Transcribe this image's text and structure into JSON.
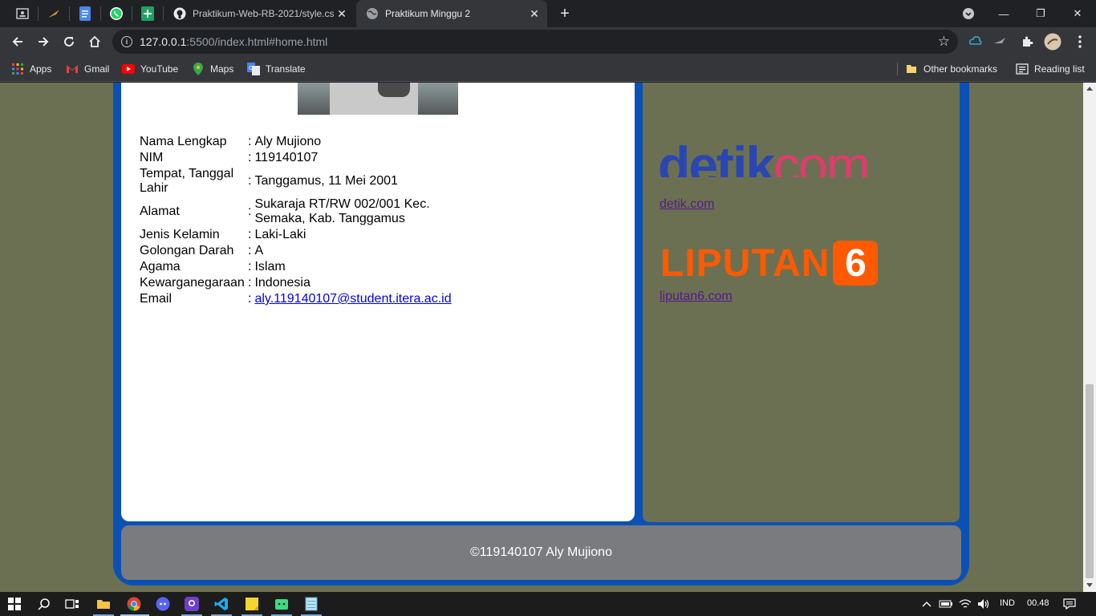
{
  "browser": {
    "tabs": [
      {
        "title": "Praktikum-Web-RB-2021/style.cs",
        "active": false,
        "icon": "github-icon"
      },
      {
        "title": "Praktikum Minggu 2",
        "active": true,
        "icon": "globe-icon"
      }
    ],
    "url_host": "127.0.0.1",
    "url_path": ":5500/index.html#home.html",
    "bookmarks": [
      {
        "label": "Apps",
        "icon": "apps-grid-icon"
      },
      {
        "label": "Gmail",
        "icon": "gmail-icon"
      },
      {
        "label": "YouTube",
        "icon": "youtube-icon"
      },
      {
        "label": "Maps",
        "icon": "maps-pin-icon"
      },
      {
        "label": "Translate",
        "icon": "translate-icon"
      }
    ],
    "other_bookmarks": "Other bookmarks",
    "reading_list": "Reading list"
  },
  "profile": {
    "rows": [
      {
        "key": "Nama Lengkap",
        "sep": ":",
        "value": "Aly Mujiono"
      },
      {
        "key": "NIM",
        "sep": ":",
        "value": "119140107"
      },
      {
        "key": "Tempat, Tanggal Lahir",
        "sep": ":",
        "value": "Tanggamus, 11 Mei 2001"
      },
      {
        "key": "Alamat",
        "sep": ":",
        "value": "Sukaraja RT/RW 002/001 Kec. Semaka, Kab. Tanggamus"
      },
      {
        "key": "Jenis Kelamin",
        "sep": ":",
        "value": "Laki-Laki"
      },
      {
        "key": "Golongan Darah",
        "sep": ":",
        "value": "A"
      },
      {
        "key": "Agama",
        "sep": ":",
        "value": "Islam"
      },
      {
        "key": "Kewarganegaraan",
        "sep": ":",
        "value": "Indonesia"
      },
      {
        "key": "Email",
        "sep": ":",
        "value": "aly.119140107@student.itera.ac.id"
      }
    ]
  },
  "sidebar": {
    "detik_logo_a": "detik",
    "detik_logo_b": "com",
    "detik_link": "detik.com",
    "liputan_logo_text": "LIPUTAN",
    "liputan_logo_num": "6",
    "liputan_link": "liputan6.com"
  },
  "footer": {
    "text": "©119140107 Aly Mujiono"
  },
  "taskbar": {
    "language": "IND",
    "time": "00.48"
  }
}
